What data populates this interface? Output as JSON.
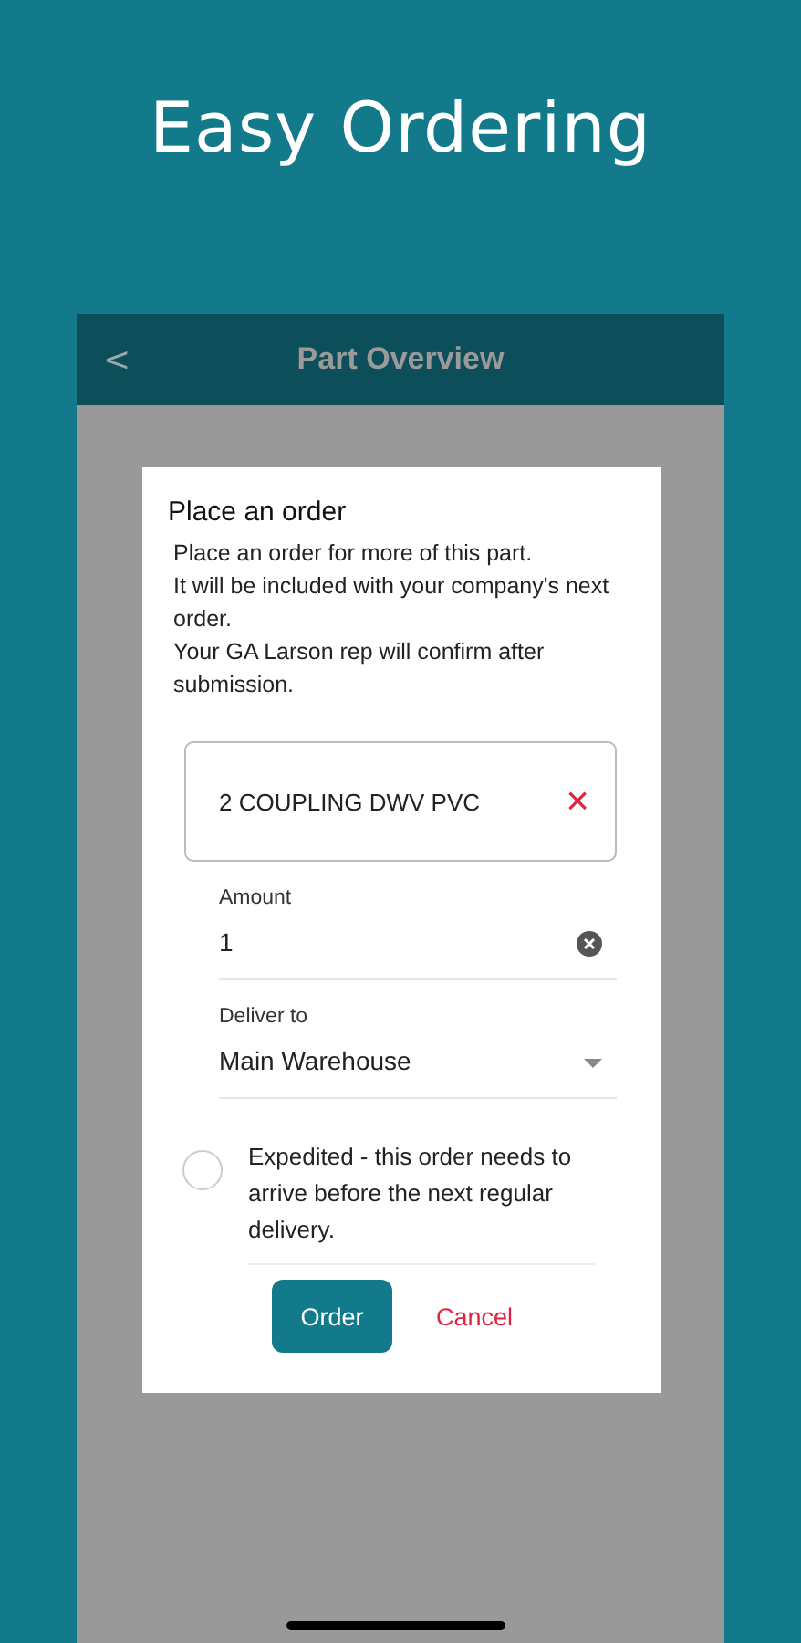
{
  "headline": "Easy Ordering",
  "nav": {
    "back": "<",
    "title": "Part Overview"
  },
  "dialog": {
    "title": "Place an order",
    "message": "Place an order for more of this part.\nIt will be included with your company's next order.\nYour GA Larson rep will confirm after submission.",
    "part": {
      "name": "2 COUPLING DWV PVC",
      "remove": "×"
    },
    "fields": [
      {
        "kind": "text",
        "label": "Amount",
        "value": "1"
      },
      {
        "kind": "select",
        "label": "Deliver to",
        "value": "Main Warehouse"
      }
    ],
    "expedited": {
      "checked": false,
      "label": "Expedited - this order needs to arrive before the next regular delivery."
    },
    "buttons": [
      {
        "kind": "primary",
        "label": "Order"
      },
      {
        "kind": "cancel",
        "label": "Cancel"
      }
    ]
  }
}
